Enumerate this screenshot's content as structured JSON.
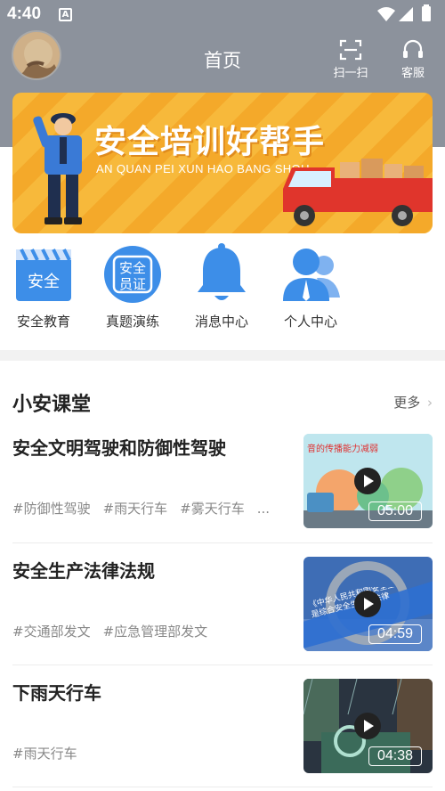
{
  "status_bar": {
    "time": "4:40",
    "notification_badge": "A"
  },
  "header": {
    "title": "首页",
    "scan_label": "扫一扫",
    "service_label": "客服"
  },
  "banner": {
    "title": "安全培训好帮手",
    "subtitle": "AN QUAN PEI XUN HAO BANG SHOU"
  },
  "quick_menu": [
    {
      "label": "安全教育",
      "icon": "safety-education-icon",
      "icon_text": "安全"
    },
    {
      "label": "真题演练",
      "icon": "certificate-icon",
      "icon_text": "安全员证"
    },
    {
      "label": "消息中心",
      "icon": "bell-icon"
    },
    {
      "label": "个人中心",
      "icon": "user-icon"
    }
  ],
  "section": {
    "title": "小安课堂",
    "more_label": "更多"
  },
  "courses": [
    {
      "title": "安全文明驾驶和防御性驾驶",
      "tags": [
        "#防御性驾驶",
        "#雨天行车",
        "#雾天行车"
      ],
      "overflow": "...",
      "duration": "05:00",
      "thumb_caption": "音的传播能力减弱"
    },
    {
      "title": "安全生产法律法规",
      "tags": [
        "#交通部发文",
        "#应急管理部发文"
      ],
      "duration": "04:59",
      "thumb_caption": "《中华人民共和国安全生产法》是综合安全生产的法律"
    },
    {
      "title": "下雨天行车",
      "tags": [
        "#雨天行车"
      ],
      "duration": "04:38"
    }
  ],
  "colors": {
    "header_bg": "#8c929c",
    "banner_orange": "#f7b93b",
    "icon_blue": "#3d8ee8"
  }
}
